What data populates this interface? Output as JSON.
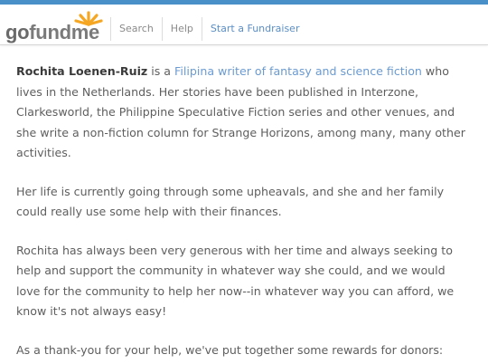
{
  "brand": {
    "logo_text_go": "go",
    "logo_text_fund": "fund",
    "logo_text_me": "me",
    "logo_icon": "sun-rays-icon",
    "accent_color": "#4a90c8",
    "sun_color": "#f5a623"
  },
  "nav": {
    "search_label": "Search",
    "help_label": "Help",
    "start_label": "Start a Fundraiser"
  },
  "content": {
    "p1": {
      "name": "Rochita Loenen-Ruiz",
      "before_link": " is a ",
      "link_text": "Filipina writer of fantasy and science fiction",
      "after_link": "  who lives in the Netherlands.  Her stories have been published in Interzone, Clarkesworld, the Philippine Speculative Fiction series and other venues, and she write a non-fiction column for Strange Horizons, among many, many other activities."
    },
    "p2": "Her life is currently going through some upheavals, and she and her family could really use some help with their finances.",
    "p3": "Rochita has always been very generous with her time and always seeking to help and support the community in whatever way she could, and we would love for the community to help her now--in whatever way you can afford, we know it's not always easy!",
    "p4": "As a thank-you for your help, we've put together some rewards for donors:"
  }
}
